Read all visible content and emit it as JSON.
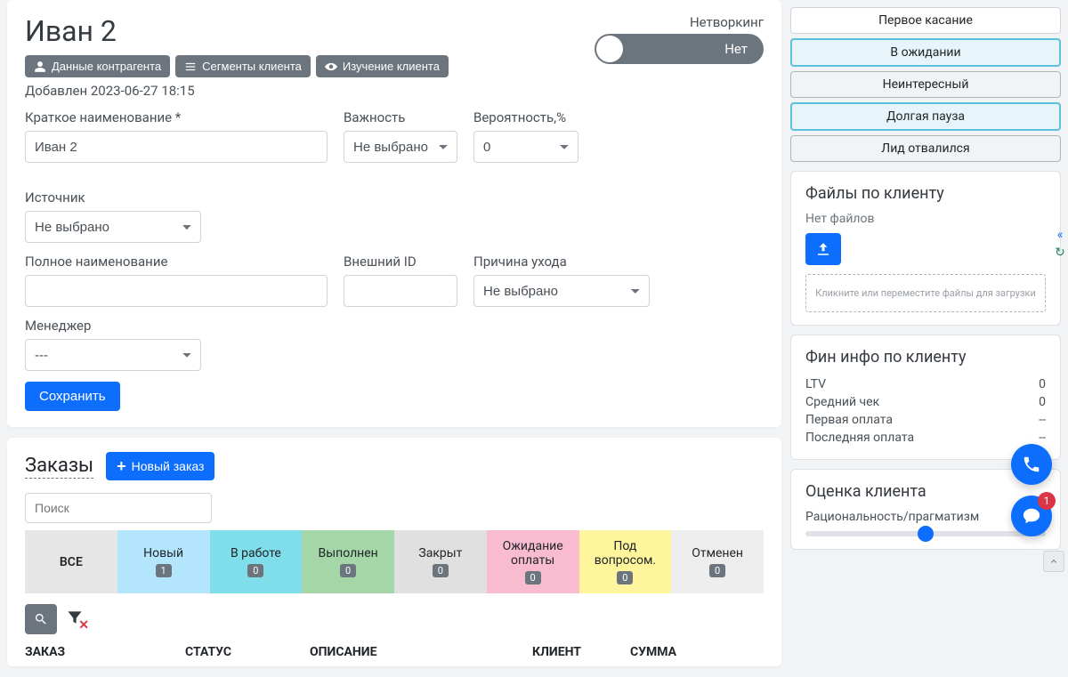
{
  "client": {
    "title": "Иван 2",
    "networking_label": "Нетворкинг",
    "networking_value": "Нет",
    "tag_buttons": {
      "data": "Данные контрагента",
      "segments": "Сегменты клиента",
      "study": "Изучение клиента"
    },
    "added_line": "Добавлен 2023-06-27 18:15",
    "fields": {
      "short_name_label": "Краткое наименование *",
      "short_name_value": "Иван 2",
      "importance_label": "Важность",
      "importance_value": "Не выбрано",
      "probability_label": "Вероятность,%",
      "probability_value": "0",
      "source_label": "Источник",
      "source_value": "Не выбрано",
      "full_name_label": "Полное наименование",
      "full_name_value": "",
      "external_id_label": "Внешний ID",
      "external_id_value": "",
      "leave_reason_label": "Причина ухода",
      "leave_reason_value": "Не выбрано",
      "manager_label": "Менеджер",
      "manager_value": "---"
    },
    "save_label": "Сохранить"
  },
  "orders": {
    "title": "Заказы",
    "new_order_label": "Новый заказ",
    "search_placeholder": "Поиск",
    "tabs": [
      {
        "key": "all",
        "label": "ВСЕ"
      },
      {
        "key": "new",
        "label": "Новый",
        "badge": "1"
      },
      {
        "key": "work",
        "label": "В работе",
        "badge": "0"
      },
      {
        "key": "done",
        "label": "Выполнен",
        "badge": "0"
      },
      {
        "key": "close",
        "label": "Закрыт",
        "badge": "0"
      },
      {
        "key": "wait",
        "label": "Ожидание оплаты",
        "badge": "0"
      },
      {
        "key": "quest",
        "label": "Под вопросом.",
        "badge": "0"
      },
      {
        "key": "cancel",
        "label": "Отменен",
        "badge": "0"
      }
    ],
    "columns": {
      "order": "ЗАКАЗ",
      "status": "СТАТУС",
      "desc": "ОПИСАНИЕ",
      "client": "КЛИЕНТ",
      "sum": "СУММА"
    }
  },
  "stages": [
    {
      "label": "Первое касание",
      "selected": false,
      "plain": true
    },
    {
      "label": "В ожидании",
      "selected": true
    },
    {
      "label": "Неинтересный",
      "selected": false
    },
    {
      "label": "Долгая пауза",
      "selected": true
    },
    {
      "label": "Лид отвалился",
      "selected": false
    }
  ],
  "files": {
    "title": "Файлы по клиенту",
    "empty": "Нет файлов",
    "dropzone": "Кликните или переместите файлы для загрузки"
  },
  "fin": {
    "title": "Фин инфо по клиенту",
    "rows": [
      {
        "label": "LTV",
        "value": "0"
      },
      {
        "label": "Средний чек",
        "value": "0"
      },
      {
        "label": "Первая оплата",
        "value": "--"
      },
      {
        "label": "Последняя оплата",
        "value": "--"
      }
    ]
  },
  "rating": {
    "title": "Оценка клиента",
    "metric": "Рациональность/прагматизм"
  },
  "fab_notif": "1"
}
